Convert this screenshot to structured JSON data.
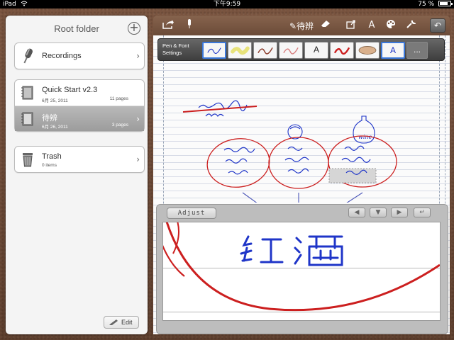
{
  "status_bar": {
    "device": "iPad",
    "time": "下午9:59",
    "battery": "75 %",
    "battery_level": 0.75
  },
  "sidebar": {
    "title": "Root folder",
    "add_label": "+",
    "edit_label": "Edit",
    "groups": [
      {
        "items": [
          {
            "name": "Recordings",
            "icon": "microphone-icon"
          }
        ]
      },
      {
        "items": [
          {
            "name": "Quick Start v2.3",
            "date": "6月 25, 2011",
            "pages": "11 pages",
            "icon": "notebook-icon"
          },
          {
            "name": "待辨",
            "date": "6月 26, 2011",
            "pages": "3 pages",
            "icon": "notebook-icon",
            "selected": true
          }
        ]
      },
      {
        "items": [
          {
            "name": "Trash",
            "sub": "0 items",
            "icon": "trash-icon"
          }
        ]
      }
    ]
  },
  "toolbar": {
    "title": "✎待辨",
    "icons": [
      "share-icon",
      "microphone-icon",
      "eraser-icon",
      "export-icon",
      "font-icon",
      "palette-icon",
      "wrench-icon",
      "undo-icon"
    ],
    "font_glyph": "A",
    "undo_glyph": "↶"
  },
  "pen_bar": {
    "label_line1": "Pen & Font",
    "label_line2": "Settings",
    "text_swatch": "A",
    "more": "...",
    "colors": {
      "blue": "#1f35c8",
      "yellow": "#e7e27a",
      "brown": "#8a3b2a",
      "pink": "#d88080",
      "red": "#cc1f1f",
      "tan": "#d9b08c"
    }
  },
  "handwriting_panel": {
    "adjust_label": "Adjust",
    "buttons": [
      "arrow-left-icon",
      "arrow-down-icon",
      "arrow-right-icon",
      "return-icon"
    ]
  },
  "note": {
    "wine_label": "wine"
  }
}
